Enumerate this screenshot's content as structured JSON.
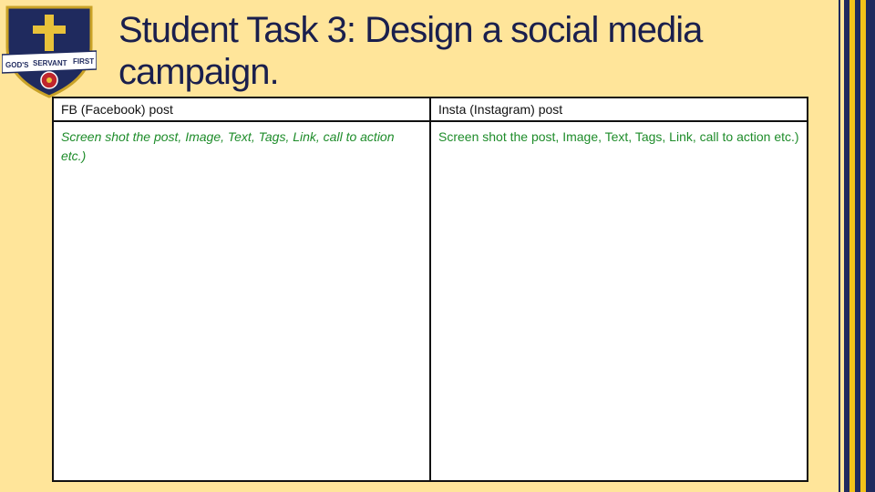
{
  "slide": {
    "title": "Student Task 3: Design a social media campaign."
  },
  "crest": {
    "motto_left": "GOD'S",
    "motto_middle": "SERVANT",
    "motto_right": "FIRST"
  },
  "table": {
    "headers": [
      "FB (Facebook) post",
      "Insta (Instagram) post"
    ],
    "cells": [
      "Screen shot the post, Image, Text, Tags, Link, call to action etc.)",
      "Screen shot the post, Image, Text, Tags, Link, call to action etc.)"
    ]
  },
  "colors": {
    "background": "#ffe59a",
    "title": "#1a1f4d",
    "instruction_text": "#1e8c2a",
    "stripe_navy": "#1f2a5e",
    "stripe_gold": "#f2c21a"
  }
}
